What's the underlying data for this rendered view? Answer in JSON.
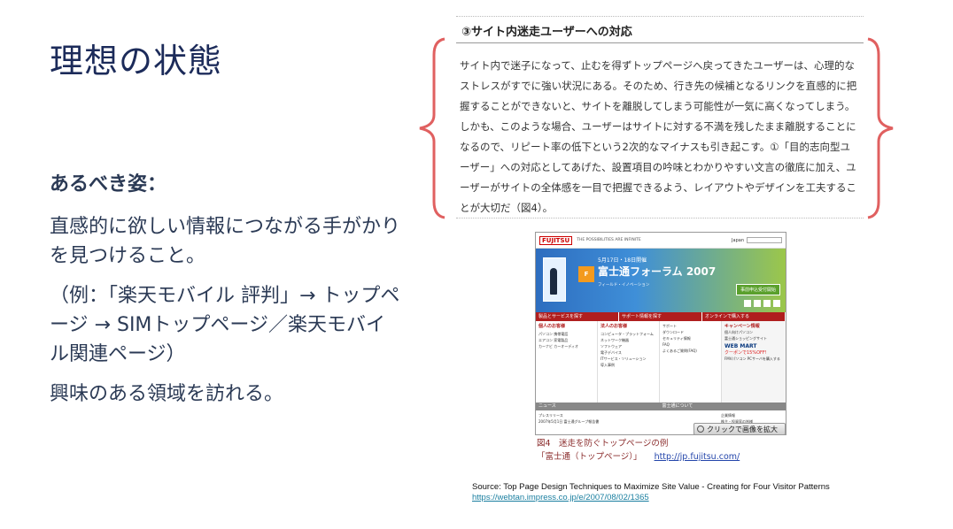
{
  "slide": {
    "title": "理想の状態",
    "subhead": "あるべき姿：",
    "paragraphs": [
      "直感的に欲しい情報につながる手がかりを見つけること。",
      "（例：「楽天モバイル 評判」→ トップページ → SIMトップページ／楽天モバイル関連ページ）",
      "興味のある領域を訪れる。"
    ]
  },
  "article": {
    "heading": "③サイト内迷走ユーザーへの対応",
    "body": "サイト内で迷子になって、止むを得ずトップページへ戻ってきたユーザーは、心理的なストレスがすでに強い状況にある。そのため、行き先の候補となるリンクを直感的に把握することができないと、サイトを離脱してしまう可能性が一気に高くなってしまう。しかも、このような場合、ユーザーはサイトに対する不満を残したまま離脱することになるので、リピート率の低下という2次的なマイナスも引き起こす。①「目的志向型ユーザー」への対応としてあげた、設置項目の吟味とわかりやすい文言の徹底に加え、ユーザーがサイトの全体感を一目で把握できるよう、レイアウトやデザインを工夫することが大切だ（図4）。",
    "brace_color": "#e06060"
  },
  "screenshot": {
    "logo": "FUJITSU",
    "tagline": "THE POSSIBILITIES ARE INFINITE",
    "japan": "Japan",
    "banner_date": "5月17日・18日開催",
    "forum_logo": "F",
    "forum_title": "富士通フォーラム 2007",
    "forum_sub": "フィールド・イノベーション",
    "register_btn": "事前申込受付開始",
    "nav": [
      "製品とサービスを探す",
      "サポート情報を探す",
      "オンラインで購入する"
    ],
    "col1_title": "個人のお客様",
    "col1_lines": [
      "パソコン 携帯電話",
      "エアコン 家電製品",
      "カーナビ カーオーディオ"
    ],
    "col2_title": "法人のお客様",
    "col2_lines": [
      "コンピュータ・プラットフォーム",
      "ネットワーク機器",
      "ソフトウェア",
      "電子デバイス",
      "ITサービス・ソリューション",
      "導入事例"
    ],
    "col3_lines": [
      "サポート",
      "ダウンロード",
      "セキュリティ情報",
      "FAQ",
      "よくあるご質問(FAQ)"
    ],
    "promo_title": "キャンペーン情報",
    "promo_lines": [
      "個人向けパソコン",
      "富士通ショッピングサイト"
    ],
    "webmart": "WEB MART",
    "promo_off": "クーポンで15%OFF!",
    "fmv": "FMVパソコン PCサーバを購入する",
    "news_label": "ニュース",
    "news_right_label": "富士通について",
    "news_lines": [
      "プレスリリース",
      "2007年5月1日 富士通グループ報告書"
    ],
    "news_right_lines": [
      "企業情報",
      "株主・投資家の皆様"
    ],
    "zoom_btn": "クリックで画像を拡大"
  },
  "figure": {
    "caption_line1": "図4　迷走を防ぐトップページの例",
    "caption_line2": "「富士通（トップページ）」",
    "caption_link": "http://jp.fujitsu.com/"
  },
  "source": {
    "text": "Source: Top Page Design Techniques to Maximize Site Value - Creating for Four Visitor Patterns",
    "url": "https://webtan.impress.co.jp/e/2007/08/02/1365"
  }
}
